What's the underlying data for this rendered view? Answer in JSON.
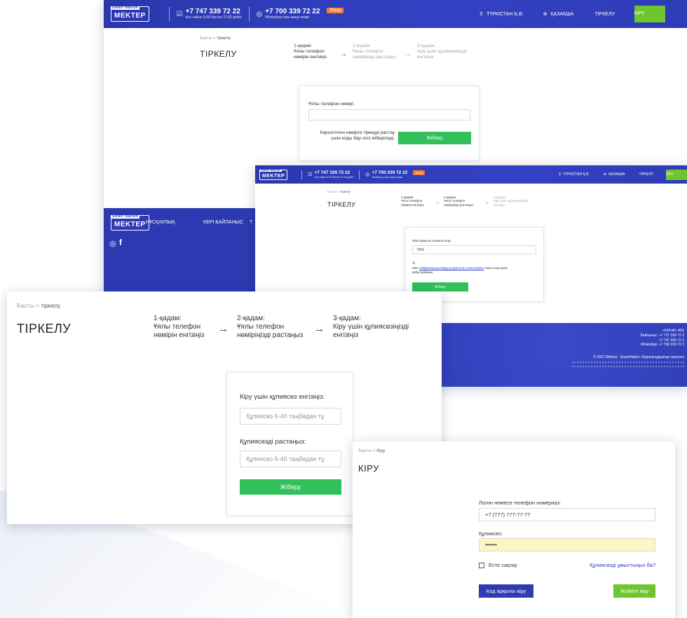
{
  "nav": {
    "logo_top": "Smart Nation",
    "logo_main": "MEKTEP",
    "phone1": "+7 747 339 72 22",
    "phone1_sub": "Күн сайын 9:00 бастап 21:00 дейін",
    "phone2": "+7 700 339 72 22",
    "phone2_sub": "WhatsApp-тағы жаңа нөмір",
    "badge": "Жаңа",
    "region": "ТҮРКІСТАН Қ.Ә.",
    "language": "ҚАЗАҚША",
    "register": "ТІРКЕЛУ",
    "login": "КІРУ"
  },
  "shot1": {
    "crumb_home": "Басты",
    "crumb_current": "тіркелу",
    "title": "ТІРКЕЛУ",
    "steps": [
      {
        "num": "1-қадам:",
        "text": "Ұялы телефон нөмірін енгізіңіз"
      },
      {
        "num": "2-қадам:",
        "text": "Ұялы телефон нөміріңізді растаңыз"
      },
      {
        "num": "3-қадам:",
        "text": "Кіру үшін құпиясөзіңізді енгізіңіз"
      }
    ],
    "phone_label": "Ұялы телефон нөмірі:",
    "hint": "Көрсетілген нөмірге тіркеуді растау үшін коды бар sms жіберіледі.",
    "submit": "Жіберу",
    "footer_links": [
      "НҰСҚАУЛЫҚ",
      "КЕРІ БАЙЛАНЫС",
      "Т"
    ]
  },
  "shot2": {
    "crumb_home": "Басты",
    "crumb_current": "тіркелу",
    "title": "ТІРКЕЛУ",
    "sms_label": "SMS арқылы алынған код:",
    "sms_value": "7889",
    "consent_prefix": "Мен ",
    "consent_link": "пайдаланушылардың деректер саясатымен",
    "consent_suffix": " таныстым және қабылдаймын",
    "submit": "Жіберу",
    "footer_lines": [
      "«InDraft» ЖШ",
      "Байланыс: +7 727 339 72 2",
      "+7 747 339 72 2",
      "WhatsApp: +7 700 339 72 2"
    ],
    "copyright": "© 2021 Mektep - SmartNation. Барлық құқықтар сақталға"
  },
  "shot3": {
    "crumb_home": "Басты",
    "crumb_current": "тіркелу",
    "title": "ТІРКЕЛУ",
    "password_label": "Кіру үшін құпиясөз енгізіңіз:",
    "password_placeholder": "Құпиясөз 6-40 таңбадан тұ",
    "confirm_label": "Құпиясөзді растаңыз:",
    "confirm_placeholder": "Құпиясөз 6-40 таңбадан тұ",
    "submit": "Жіберу"
  },
  "shot4": {
    "crumb_home": "Басты",
    "crumb_current": "Кіру",
    "title": "КІРУ",
    "login_label": "Логин немесе телефон номеріңіз:",
    "login_value": "+7 (777) 777-77-77",
    "password_label": "Құпиясөз:",
    "password_value": "••••••",
    "remember": "Есте сақтау",
    "forgot": "Құпиясөзді ұмыттыңыз ба?",
    "code_login": "Код арқылы кіру",
    "system_login": "Жүйеге кіру"
  },
  "colors": {
    "nav": "#2e3cb8",
    "green": "#31c05a",
    "login_green": "#6fc52d",
    "badge": "#f5802e",
    "code_btn": "#2f3bb0"
  }
}
